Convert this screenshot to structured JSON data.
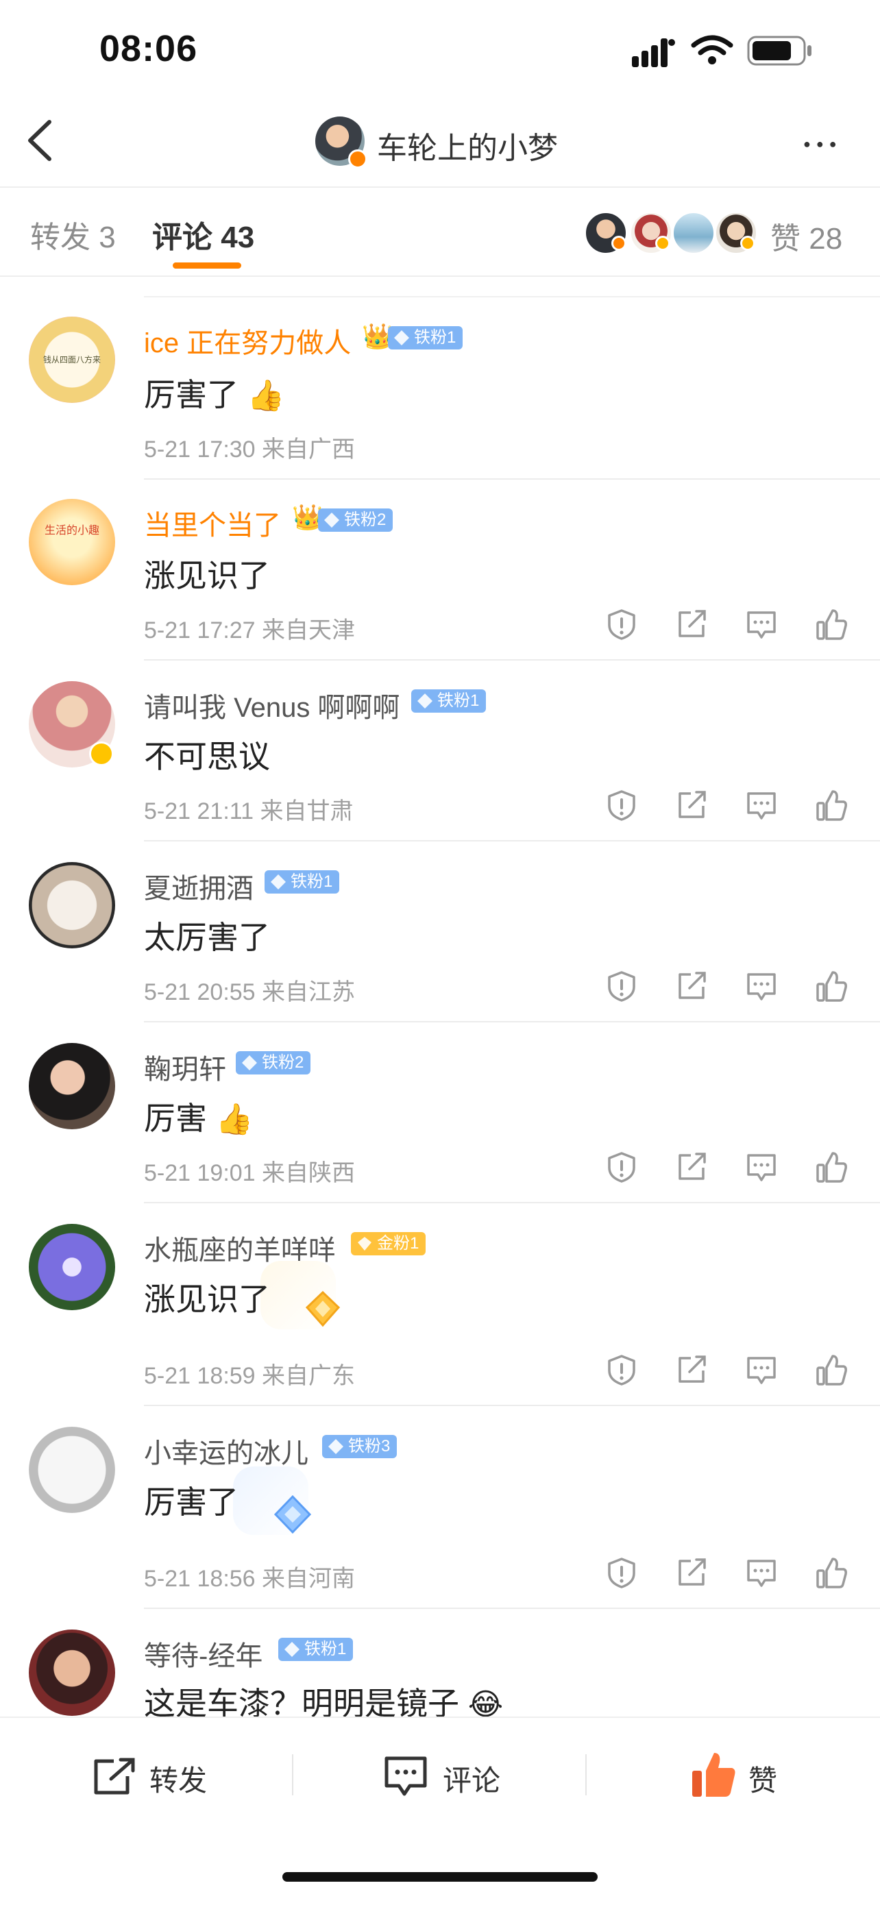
{
  "status_bar": {
    "time": "08:06"
  },
  "nav": {
    "title": "车轮上的小梦"
  },
  "tabs": [
    {
      "label": "转发 3"
    },
    {
      "label": "评论 43"
    }
  ],
  "likes": {
    "label": "赞 28"
  },
  "comments": [
    {
      "name": "ice 正在努力做人",
      "badge": "铁粉1",
      "text": "厉害了",
      "time": "5-21 17:30",
      "location": "来自广西",
      "avatar_text": "钱从四面八方来"
    },
    {
      "name": "当里个当了",
      "badge": "铁粉2",
      "text": "涨见识了",
      "time": "5-21 17:27",
      "location": "来自天津",
      "avatar_text": "生活的小趣"
    },
    {
      "name": "请叫我 Venus 啊啊啊",
      "badge": "铁粉1",
      "text": "不可思议",
      "time": "5-21 21:11",
      "location": "来自甘肃"
    },
    {
      "name": "夏逝拥酒",
      "badge": "铁粉1",
      "text": "太厉害了",
      "time": "5-21 20:55",
      "location": "来自江苏"
    },
    {
      "name": "鞠玥轩",
      "badge": "铁粉2",
      "text": "厉害",
      "time": "5-21 19:01",
      "location": "来自陕西"
    },
    {
      "name": "水瓶座的羊咩咩",
      "badge": "金粉1",
      "text": "涨见识了",
      "time": "5-21 18:59",
      "location": "来自广东"
    },
    {
      "name": "小幸运的冰儿",
      "badge": "铁粉3",
      "text": "厉害了",
      "time": "5-21 18:56",
      "location": "来自河南"
    },
    {
      "name": "等待-经年",
      "badge": "铁粉1",
      "text": "这是车漆？明明是镜子"
    }
  ],
  "bottom_bar": {
    "repost": "转发",
    "comment": "评论",
    "like": "赞"
  },
  "icons": [
    "back-icon",
    "more-icon",
    "report-icon",
    "share-icon",
    "reply-icon",
    "like-icon",
    "signal-icon",
    "wifi-icon",
    "battery-icon"
  ],
  "colors": {
    "accent": "#ff8200",
    "badge_blue": "#7fb4f5",
    "badge_gold": "#ffc23c"
  }
}
